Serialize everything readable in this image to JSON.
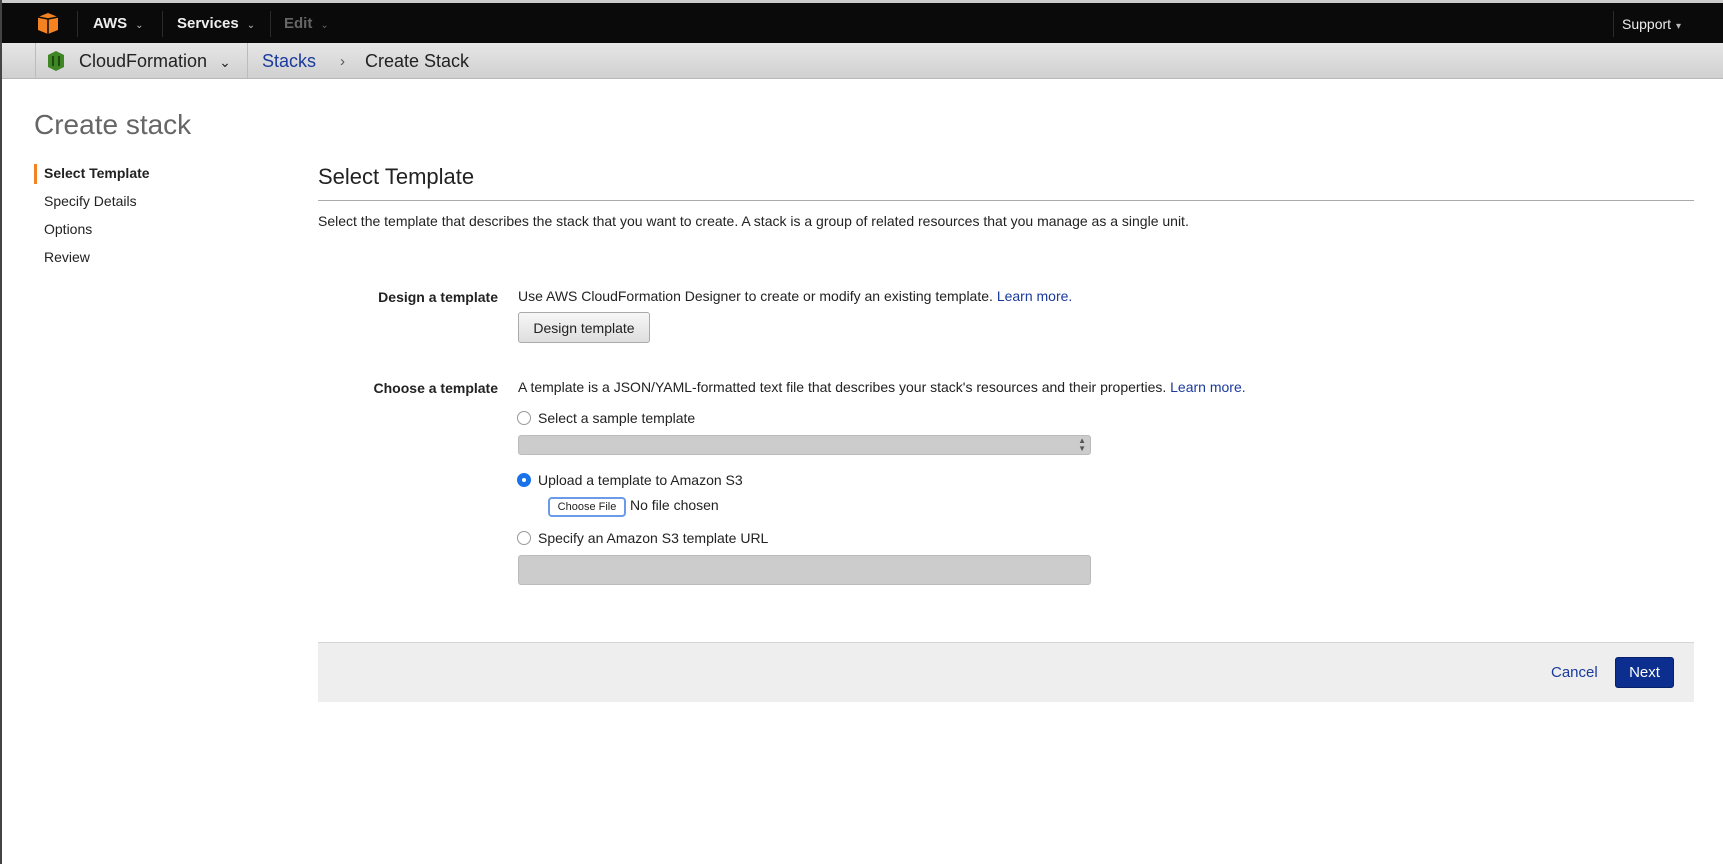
{
  "topbar": {
    "aws": "AWS",
    "services": "Services",
    "edit": "Edit",
    "support": "Support"
  },
  "subbar": {
    "service": "CloudFormation",
    "breadcrumb_link": "Stacks",
    "breadcrumb_sep": "›",
    "breadcrumb_current": "Create Stack"
  },
  "page_title": "Create stack",
  "steps": [
    "Select Template",
    "Specify Details",
    "Options",
    "Review"
  ],
  "section": {
    "title": "Select Template",
    "description": "Select the template that describes the stack that you want to create. A stack is a group of related resources that you manage as a single unit."
  },
  "design": {
    "label": "Design a template",
    "text": "Use AWS CloudFormation Designer to create or modify an existing template.",
    "learn_more": "Learn more.",
    "button": "Design template"
  },
  "choose": {
    "label": "Choose a template",
    "text": "A template is a JSON/YAML-formatted text file that describes your stack's resources and their properties.",
    "learn_more": "Learn more.",
    "options": [
      {
        "label": "Select a sample template",
        "selected": false
      },
      {
        "label": "Upload a template to Amazon S3",
        "selected": true
      },
      {
        "label": "Specify an Amazon S3 template URL",
        "selected": false
      }
    ],
    "choose_file": "Choose File",
    "file_status": "No file chosen",
    "sample_select_value": "",
    "url_value": ""
  },
  "footer": {
    "cancel": "Cancel",
    "next": "Next"
  },
  "colors": {
    "accent": "#f58220",
    "primary": "#0b2e8f",
    "link": "#1a3a9c"
  }
}
